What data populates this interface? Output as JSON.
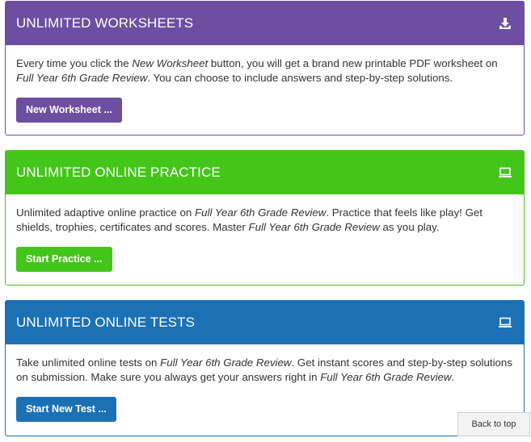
{
  "cards": [
    {
      "title": "UNLIMITED WORKSHEETS",
      "icon": "download-icon",
      "color": "#6c4fa0",
      "body": {
        "p1": "Every time you click the ",
        "em1": "New Worksheet",
        "p2": " button, you will get a brand new printable PDF worksheet on ",
        "em2": "Full Year 6th Grade Review",
        "p3": ". You can choose to include answers and step-by-step solutions."
      },
      "button": "New Worksheet ..."
    },
    {
      "title": "UNLIMITED ONLINE PRACTICE",
      "icon": "laptop-icon",
      "color": "#44c51a",
      "body": {
        "p1": "Unlimited adaptive online practice on ",
        "em1": "Full Year 6th Grade Review",
        "p2": ". Practice that feels like play! Get shields, trophies, certificates and scores. Master ",
        "em2": "Full Year 6th Grade Review",
        "p3": " as you play."
      },
      "button": "Start Practice ..."
    },
    {
      "title": "UNLIMITED ONLINE TESTS",
      "icon": "laptop-icon",
      "color": "#1c71b4",
      "body": {
        "p1": "Take unlimited online tests on ",
        "em1": "Full Year 6th Grade Review",
        "p2": ". Get instant scores and step-by-step solutions on submission. Make sure you always get your answers right in ",
        "em2": "Full Year 6th Grade Review",
        "p3": "."
      },
      "button": "Start New Test ..."
    }
  ],
  "back_to_top": "Back to top"
}
